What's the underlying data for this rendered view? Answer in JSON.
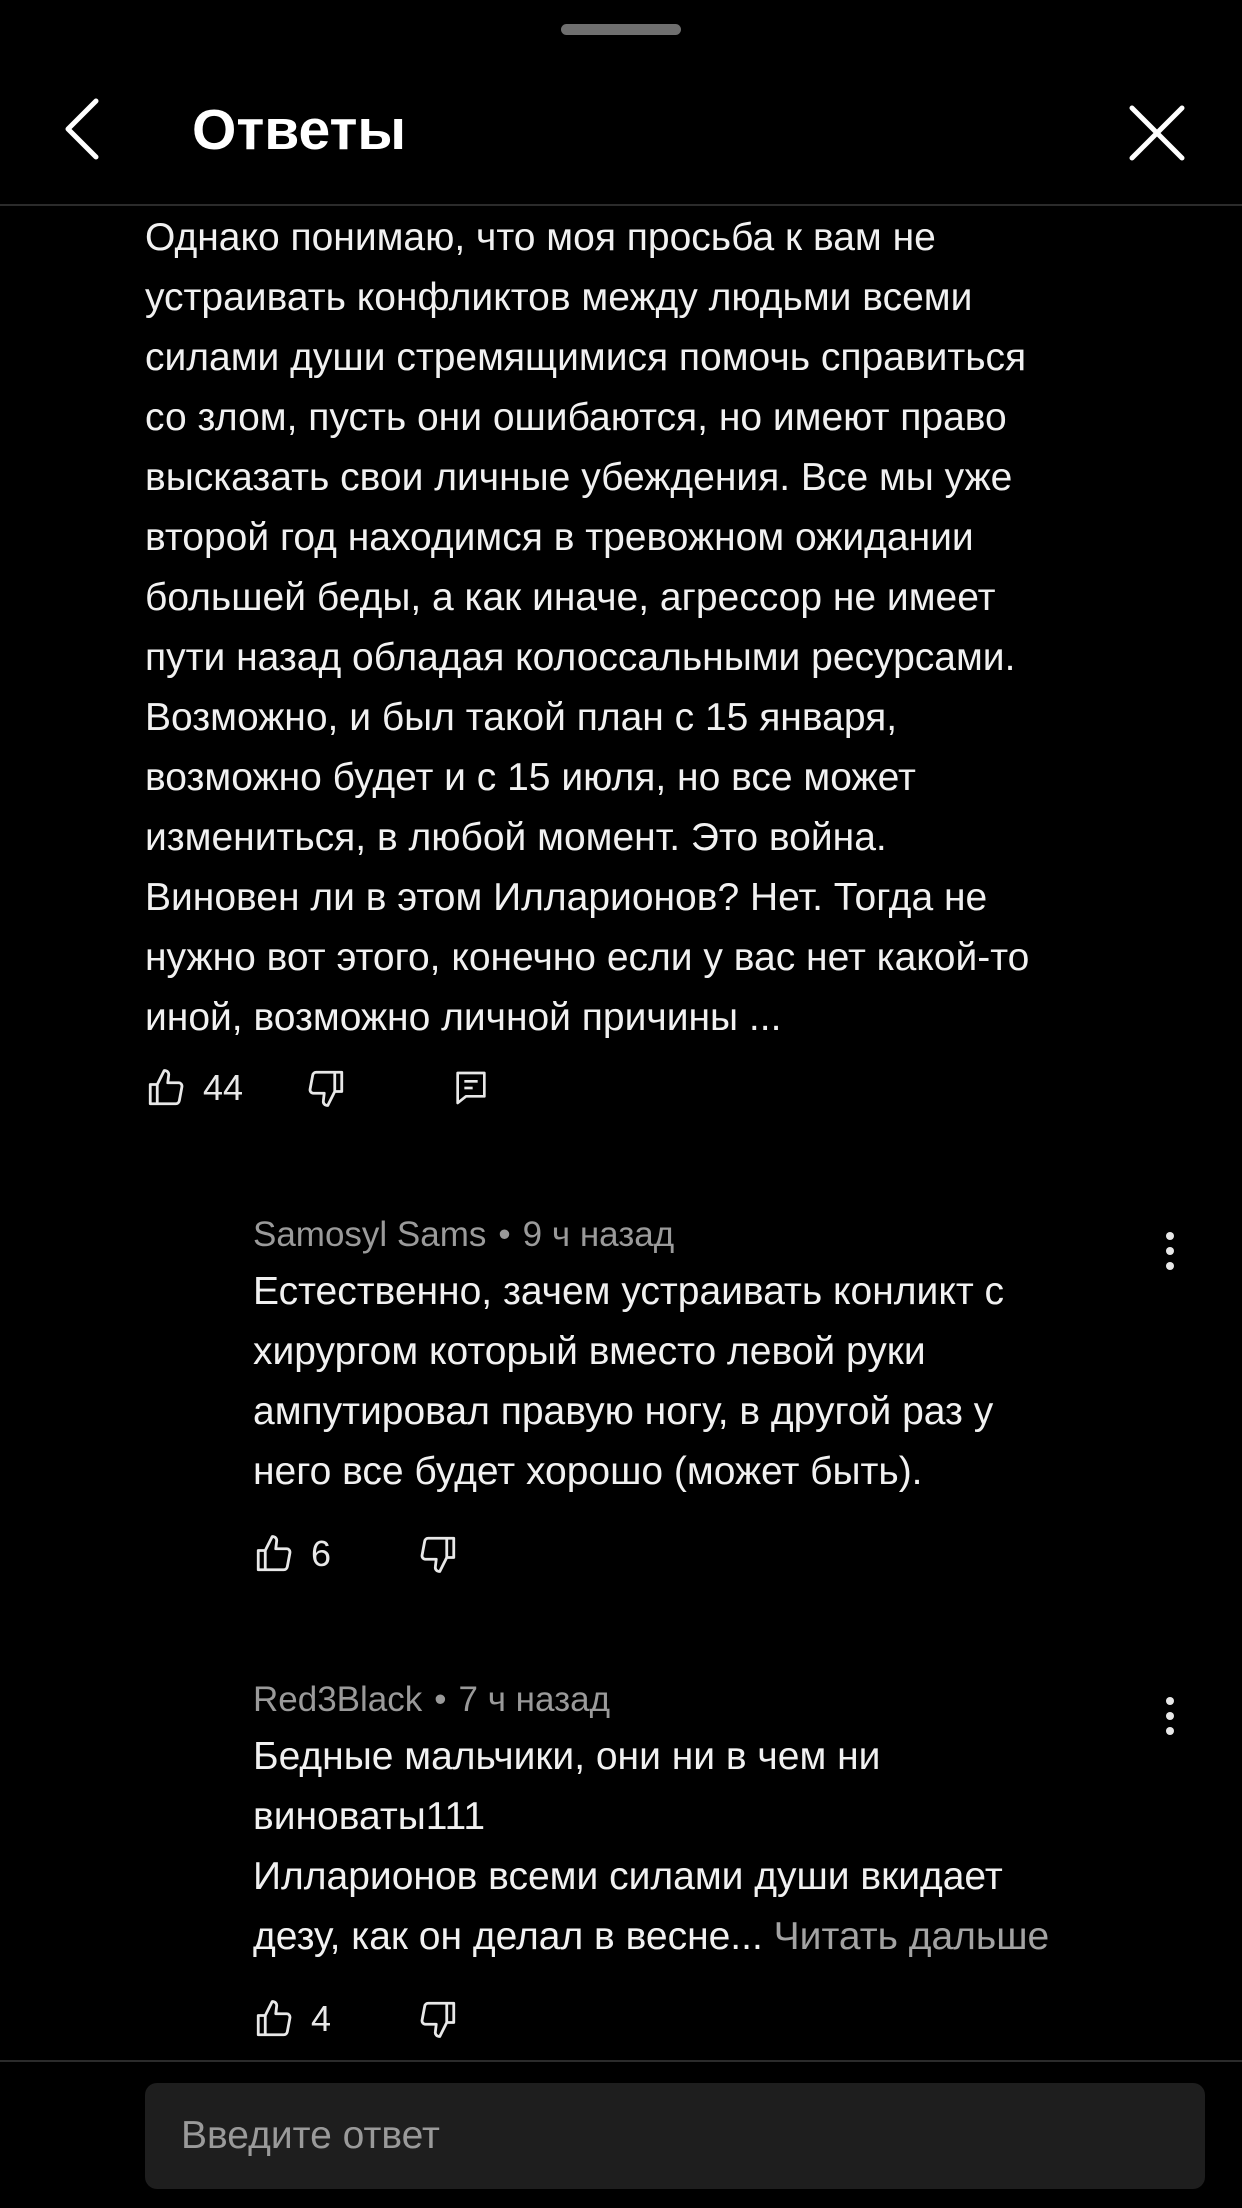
{
  "header": {
    "title": "Ответы",
    "back_icon": "chevron-left-icon",
    "close_icon": "close-icon"
  },
  "main_comment": {
    "lines": [
      "Однако понимаю, что моя просьба к вам не",
      "устраивать конфликтов между людьми всеми",
      "силами души стремящимися помочь справиться",
      "со злом, пусть они ошибаются, но имеют право",
      "высказать свои личные убеждения. Все мы уже",
      "второй год находимся в тревожном ожидании",
      "большей беды, а как иначе, агрессор не имеет",
      "пути назад обладая колоссальными ресурсами.",
      "Возможно, и был такой план с 15 января,",
      "возможно будет и с 15 июля, но все может",
      "измениться, в любой момент. Это война.",
      "Виновен ли в этом Илларионов? Нет. Тогда не",
      "нужно вот этого, конечно если у вас нет какой-то",
      "иной, возможно личной причины ..."
    ],
    "likes": "44"
  },
  "replies": [
    {
      "author": "Samosyl Sams",
      "separator": "•",
      "time": "9 ч назад",
      "lines": [
        "Естественно, зачем устраивать конликт с",
        "хирургом который вместо левой руки",
        "ампутировал правую ногу, в другой раз у",
        "него все будет хорошо (может быть)."
      ],
      "likes": "6"
    },
    {
      "author": "Red3Black",
      "separator": "•",
      "time": "7 ч назад",
      "lines": [
        "Бедные мальчики, они ни в чем ни",
        "виноваты111",
        "Илларионов всеми силами души вкидает",
        "дезу, как он делал в весне..."
      ],
      "read_more": "Читать дальше",
      "likes": "4"
    }
  ],
  "footer": {
    "placeholder": "Введите ответ"
  }
}
